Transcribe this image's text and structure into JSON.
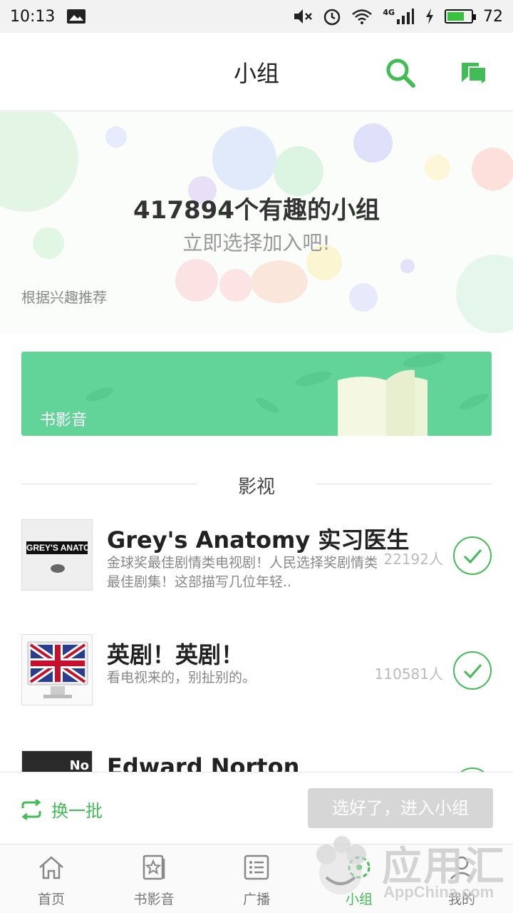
{
  "status_bar": {
    "time": "10:13",
    "battery": "72",
    "battery_level": 0.72,
    "network": "4G"
  },
  "app_bar": {
    "title": "小组"
  },
  "hero": {
    "count_text": "417894个有趣的小组",
    "subtitle": "立即选择加入吧!",
    "recommend_label": "根据兴趣推荐"
  },
  "banner": {
    "label": "书影音"
  },
  "section": {
    "title": "影视"
  },
  "groups": [
    {
      "title": "Grey's Anatomy 实习医生",
      "desc": "金球奖最佳剧情类电视剧！人民选择奖剧情类最佳剧集！这部描写几位年轻..",
      "members": "22192人",
      "thumb_text": "GREY'S ANATOMY"
    },
    {
      "title": "英剧！英剧！",
      "desc": "看电视来的，别扯别的。",
      "members": "110581人"
    },
    {
      "title": "Edward Norton",
      "thumb_text": "No"
    }
  ],
  "action_bar": {
    "refresh_label": "换一批",
    "enter_label": "选好了，进入小组"
  },
  "tabs": [
    {
      "label": "首页",
      "icon": "home-icon"
    },
    {
      "label": "书影音",
      "icon": "star-card-icon"
    },
    {
      "label": "广播",
      "icon": "list-icon"
    },
    {
      "label": "小组",
      "icon": "group-icon"
    },
    {
      "label": "我的",
      "icon": "profile-icon"
    }
  ],
  "watermark": {
    "brand": "应用汇",
    "site": "AppChina.com"
  },
  "colors": {
    "accent": "#42bd56",
    "banner": "#62d49a",
    "button_disabled": "#d6d6d6"
  }
}
